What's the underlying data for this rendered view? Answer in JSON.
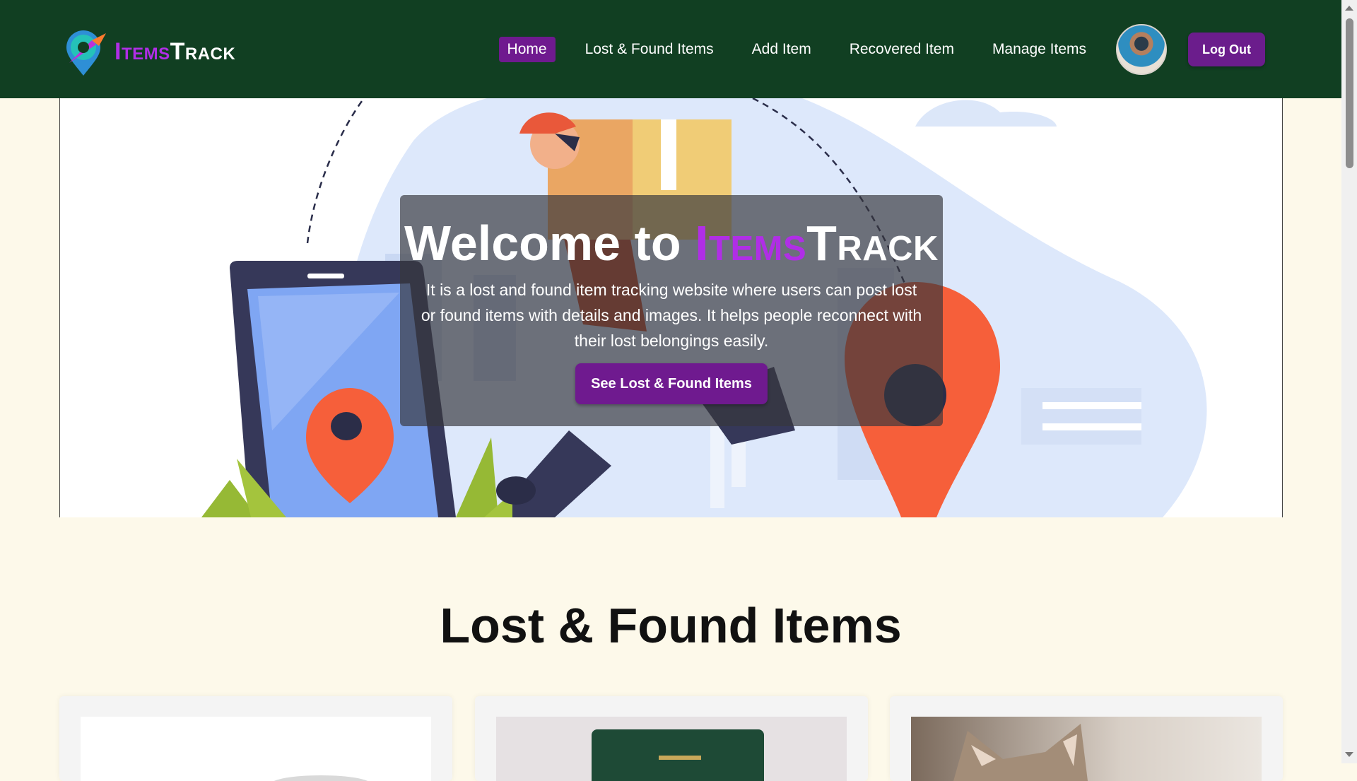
{
  "brand": {
    "part1": "Items",
    "part2": "Track"
  },
  "nav": {
    "items": [
      {
        "label": "Home",
        "active": true
      },
      {
        "label": "Lost & Found Items",
        "active": false
      },
      {
        "label": "Add Item",
        "active": false
      },
      {
        "label": "Recovered Item",
        "active": false
      },
      {
        "label": "Manage Items",
        "active": false
      }
    ],
    "logout_label": "Log Out"
  },
  "hero": {
    "welcome_prefix": "Welcome to",
    "description": "It is a lost and found item tracking website where users can post lost or found items with details and images. It helps people reconnect with their lost belongings easily.",
    "button_label": "See Lost & Found Items"
  },
  "section": {
    "title": "Lost & Found Items"
  },
  "colors": {
    "nav_bg": "#113f22",
    "accent_purple": "#6f1a8f",
    "brand_purple": "#b02ee6",
    "page_bg": "#fdf9ea"
  },
  "icons": [
    "location-pin-logo-icon",
    "user-avatar"
  ]
}
